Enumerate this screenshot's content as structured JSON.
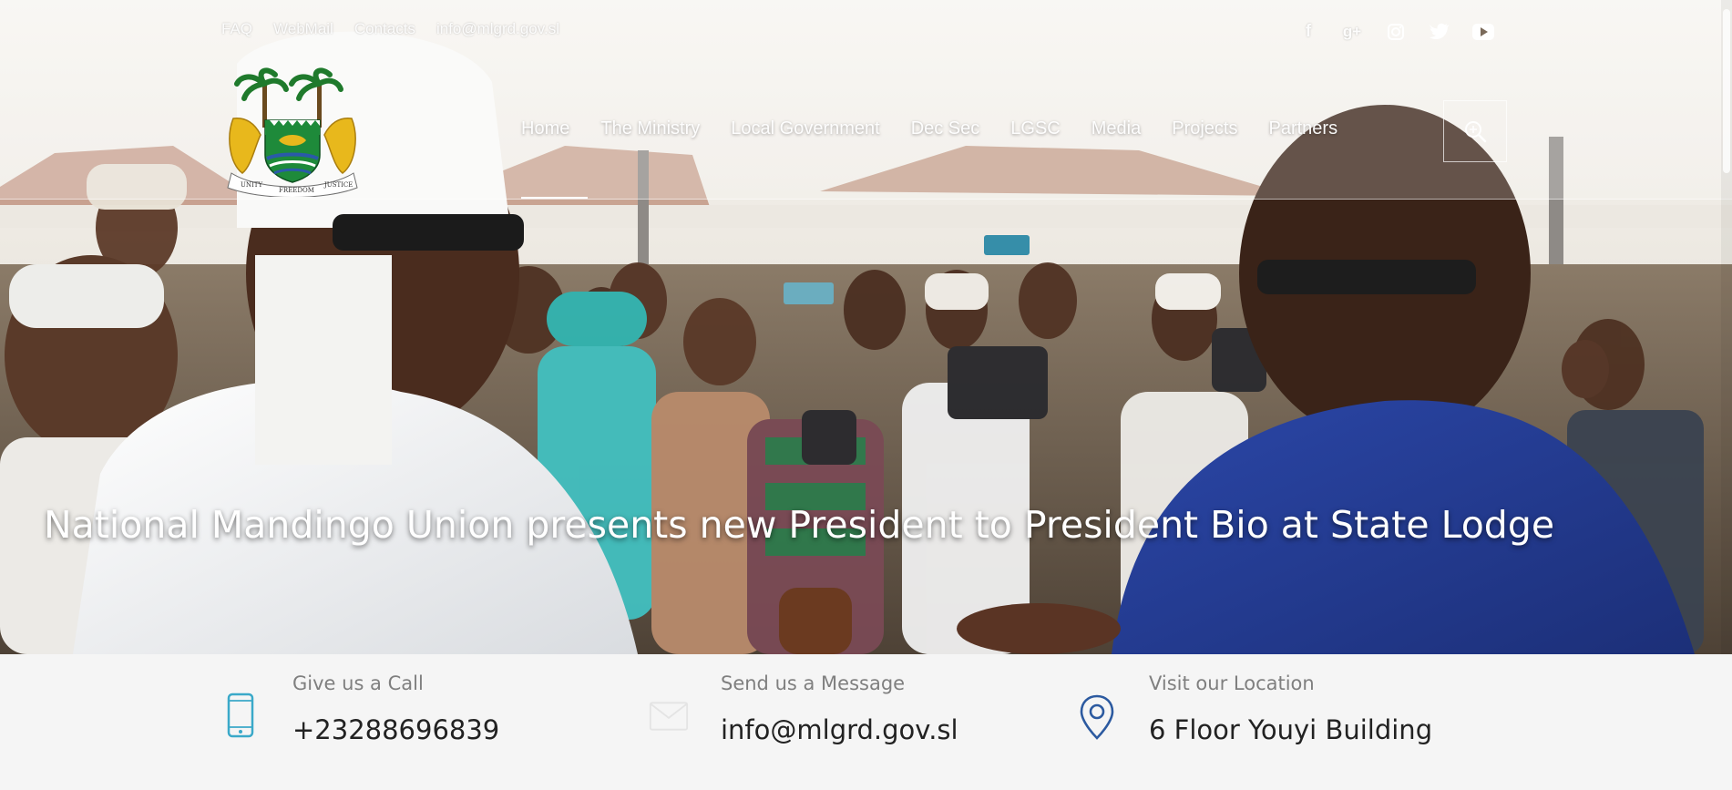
{
  "top_bar": {
    "links": [
      "FAQ",
      "WebMail",
      "Contacts",
      "info@mlgrd.gov.sl"
    ],
    "social_icons": [
      "facebook-icon",
      "google-plus-icon",
      "instagram-icon",
      "twitter-icon",
      "youtube-icon"
    ]
  },
  "logo": {
    "motto_words": [
      "UNITY",
      "FREEDOM",
      "JUSTICE"
    ]
  },
  "nav": {
    "items": [
      "Home",
      "The Ministry",
      "Local Government",
      "Dec Sec",
      "LGSC",
      "Media",
      "Projects",
      "Partners"
    ],
    "active": "Home",
    "search_icon": "search-icon"
  },
  "hero": {
    "caption": "National Mandingo Union presents new President to President Bio at State Lodge"
  },
  "contact": {
    "call": {
      "label": "Give us a Call",
      "value": "+23288696839",
      "icon": "phone-icon"
    },
    "message": {
      "label": "Send us a Message",
      "value": "info@mlgrd.gov.sl",
      "icon": "envelope-icon"
    },
    "location": {
      "label": "Visit our Location",
      "value": "6 Floor Youyi Building",
      "icon": "map-pin-icon"
    }
  },
  "colors": {
    "contact_background": "#f5f5f5",
    "phone_icon": "#3aa9c9",
    "pin_icon": "#2c5aa0",
    "label_text": "#7f7f7f",
    "value_text": "#222222"
  }
}
